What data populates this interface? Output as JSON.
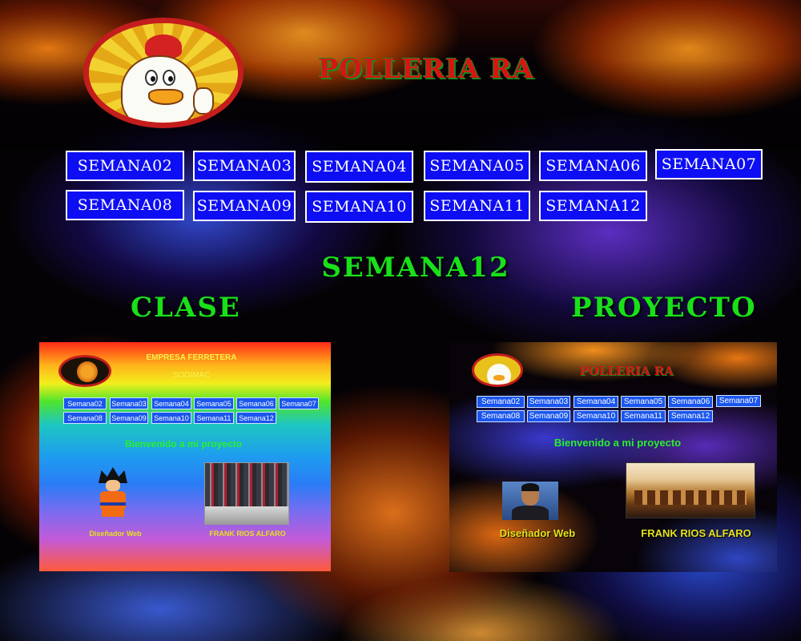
{
  "header": {
    "site_title": "POLLERIA RA",
    "logo_icon": "chicken-mascot-logo"
  },
  "nav": {
    "items": [
      {
        "label": "SEMANA02"
      },
      {
        "label": "SEMANA03"
      },
      {
        "label": "SEMANA04"
      },
      {
        "label": "SEMANA05"
      },
      {
        "label": "SEMANA06"
      },
      {
        "label": "SEMANA07"
      },
      {
        "label": "SEMANA08"
      },
      {
        "label": "SEMANA09"
      },
      {
        "label": "SEMANA10"
      },
      {
        "label": "SEMANA11"
      },
      {
        "label": "SEMANA12"
      }
    ]
  },
  "main": {
    "page_heading": "SEMANA12",
    "clase_title": "CLASE",
    "proyecto_title": "PROYECTO"
  },
  "clase_preview": {
    "company_line1": "EMPRESA FERRETERA",
    "company_line2": "SODIMAC",
    "nav": [
      "Semana02",
      "Semana03",
      "Semana04",
      "Semana05",
      "Semana06",
      "Semana07",
      "Semana08",
      "Semana09",
      "Semana10",
      "Semana11",
      "Semana12"
    ],
    "welcome": "Bienvenido a mi proyecto",
    "caption_left": "Diseñador Web",
    "caption_right": "FRANK RIOS ALFARO"
  },
  "proyecto_preview": {
    "site_title": "POLLERIA RA",
    "nav": [
      "Semana02",
      "Semana03",
      "Semana04",
      "Semana05",
      "Semana06",
      "Semana07",
      "Semana08",
      "Semana09",
      "Semana10",
      "Semana11",
      "Semana12"
    ],
    "welcome": "Bienvenido a mi proyecto",
    "caption_left": "Diseñador Web",
    "caption_right": "FRANK RIOS ALFARO"
  },
  "colors": {
    "nav_button_bg": "#0e0ef4",
    "title_red": "#d81414",
    "heading_green": "#19e019"
  }
}
